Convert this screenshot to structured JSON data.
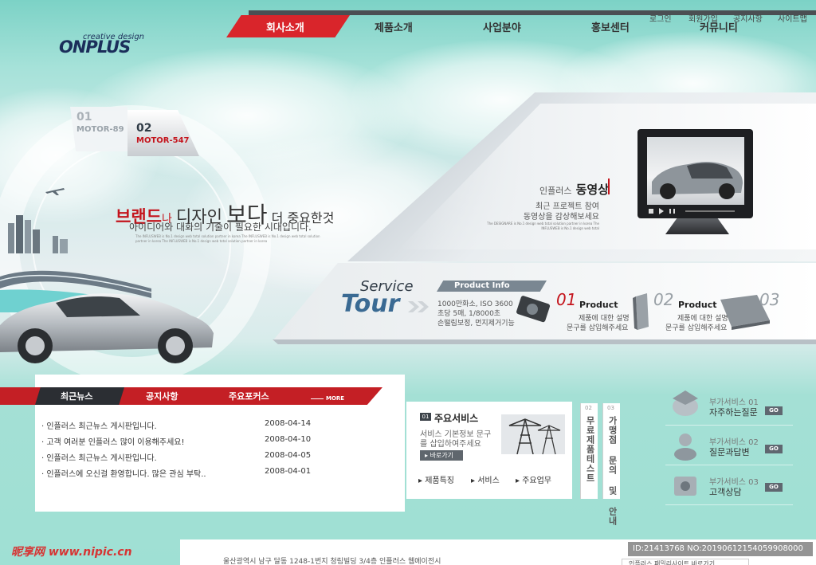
{
  "header": {
    "logo": "ONPLUS",
    "logo_tagline": "creative design",
    "nav": [
      {
        "label": "회사소개",
        "active": true
      },
      {
        "label": "제품소개"
      },
      {
        "label": "사업분야"
      },
      {
        "label": "홍보센터"
      },
      {
        "label": "커뮤니티"
      }
    ],
    "top_links": [
      "로그인",
      "회원가입",
      "공지사항",
      "사이트맵"
    ]
  },
  "hero": {
    "motor_tabs": [
      {
        "num": "01",
        "label": "MOTOR-89"
      },
      {
        "num": "02",
        "label": "MOTOR-547"
      }
    ],
    "slogan": {
      "brand": "브랜드",
      "na": "나",
      "design": "디자인",
      "bo": "보다",
      "rest": "더 중요한것",
      "line2": "아이디어와 대화의 기술이 필요한 시대입니다.",
      "small": "The INFLUSWEB is No.1 design web total solution partner in korea The INFLUSWEB is No.1 design web total solution partner in korea The INFLUSWEB is No.1 design web total solution partner in korea"
    }
  },
  "video": {
    "brand": "인플러스",
    "title": "동영상",
    "line1": "최근 프로젝트 참여",
    "line2": "동영상을 감상해보세요",
    "small": "The DESIGNARE is No.1 design web total solution partner in korea The INFLUSWEB is No.1 design web total"
  },
  "tour": {
    "service": "Service",
    "tour": "Tour",
    "product_info": "Product Info",
    "info_lines": [
      "1000만화소, ISO 3600",
      "초당 5매, 1/8000초",
      "손떨림보정, 먼지제거기능"
    ],
    "items": [
      {
        "num": "01"
      },
      {
        "num": "02",
        "title": "Product",
        "l1": "제품에 대한 설명",
        "l2": "문구를 삽입해주세요"
      },
      {
        "num": "03",
        "title": "Product",
        "l1": "제품에 대한 설명",
        "l2": "문구를 삽입해주세요"
      }
    ]
  },
  "news": {
    "tabs": [
      "최근뉴스",
      "공지사항",
      "주요포커스"
    ],
    "more": "MORE",
    "items": [
      {
        "title": "인플러스 최근뉴스 게시판입니다.",
        "date": "2008-04-14"
      },
      {
        "title": "고객 여러분 인플러스 많이 이용해주세요!",
        "date": "2008-04-10"
      },
      {
        "title": "인플러스 최근뉴스 게시판입니다.",
        "date": "2008-04-05"
      },
      {
        "title": "인플러스에 오신걸 환영합니다. 많은 관심 부탁..",
        "date": "2008-04-01"
      }
    ]
  },
  "services": {
    "num": "01",
    "title": "주요서비스",
    "desc1": "서비스 기본정보 문구",
    "desc2": "를 삽입하여주세요",
    "go": "바로가기",
    "links": [
      "제품특징",
      "서비스",
      "주요업무"
    ]
  },
  "vertical": [
    {
      "num": "02",
      "text": "무료제품테스트"
    },
    {
      "num": "03",
      "text": "가맹점 문의 및 안내"
    }
  ],
  "addons": [
    {
      "label": "부가서비스 01",
      "title": "자주하는질문",
      "go": "GO"
    },
    {
      "label": "부가서비스 02",
      "title": "질문과답변",
      "go": "GO"
    },
    {
      "label": "부가서비스 03",
      "title": "고객상담",
      "go": "GO"
    }
  ],
  "footer": {
    "address": "울산광역시 남구 달동 1248-1번지 청림빌딩 3/4층 인플러스 웹에이전시",
    "family": "인플러스 패밀리사이트 바로가기"
  },
  "watermark": {
    "site": "昵享网 www.nipic.cn",
    "id": "ID:21413768 NO:20190612154059908000"
  }
}
